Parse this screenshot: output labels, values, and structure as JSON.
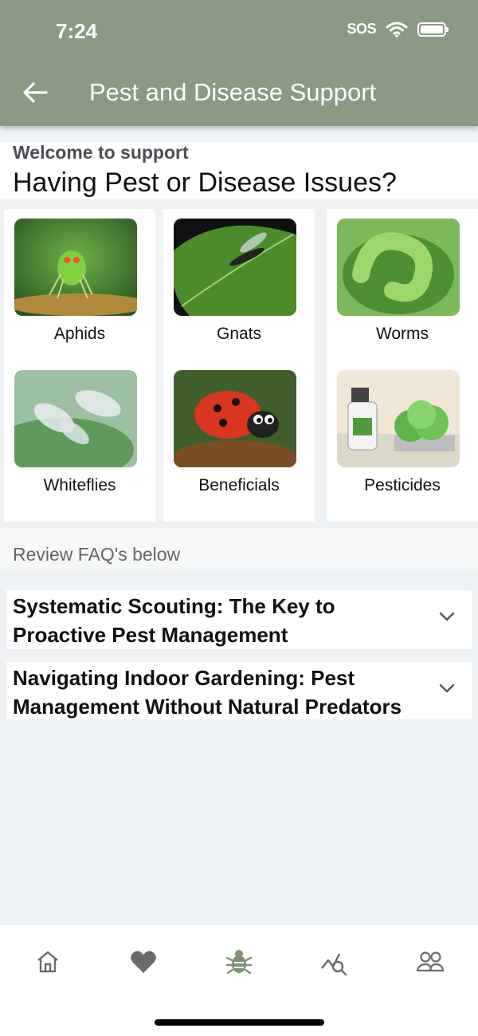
{
  "status_bar": {
    "time": "7:24",
    "carrier": "SOS"
  },
  "header": {
    "title": "Pest and Disease Support"
  },
  "welcome": {
    "subtitle": "Welcome to support",
    "heading": "Having Pest or Disease Issues?"
  },
  "categories": [
    {
      "label": "Aphids"
    },
    {
      "label": "Gnats"
    },
    {
      "label": "Worms"
    },
    {
      "label": "Whiteflies"
    },
    {
      "label": "Beneficials"
    },
    {
      "label": "Pesticides"
    }
  ],
  "faq": {
    "heading": "Review FAQ's below",
    "items": [
      {
        "title": "Systematic Scouting: The Key to Proactive Pest Management"
      },
      {
        "title": "Navigating Indoor Gardening: Pest Management Without Natural Predators"
      }
    ]
  },
  "tabbar": {
    "items": [
      {
        "icon": "home-icon"
      },
      {
        "icon": "heart-icon"
      },
      {
        "icon": "bug-icon"
      },
      {
        "icon": "chart-search-icon"
      },
      {
        "icon": "users-icon"
      }
    ]
  },
  "colors": {
    "header": "#8a9a83",
    "active_tab": "#7f9274",
    "inactive_tab": "#6b6b6b"
  }
}
